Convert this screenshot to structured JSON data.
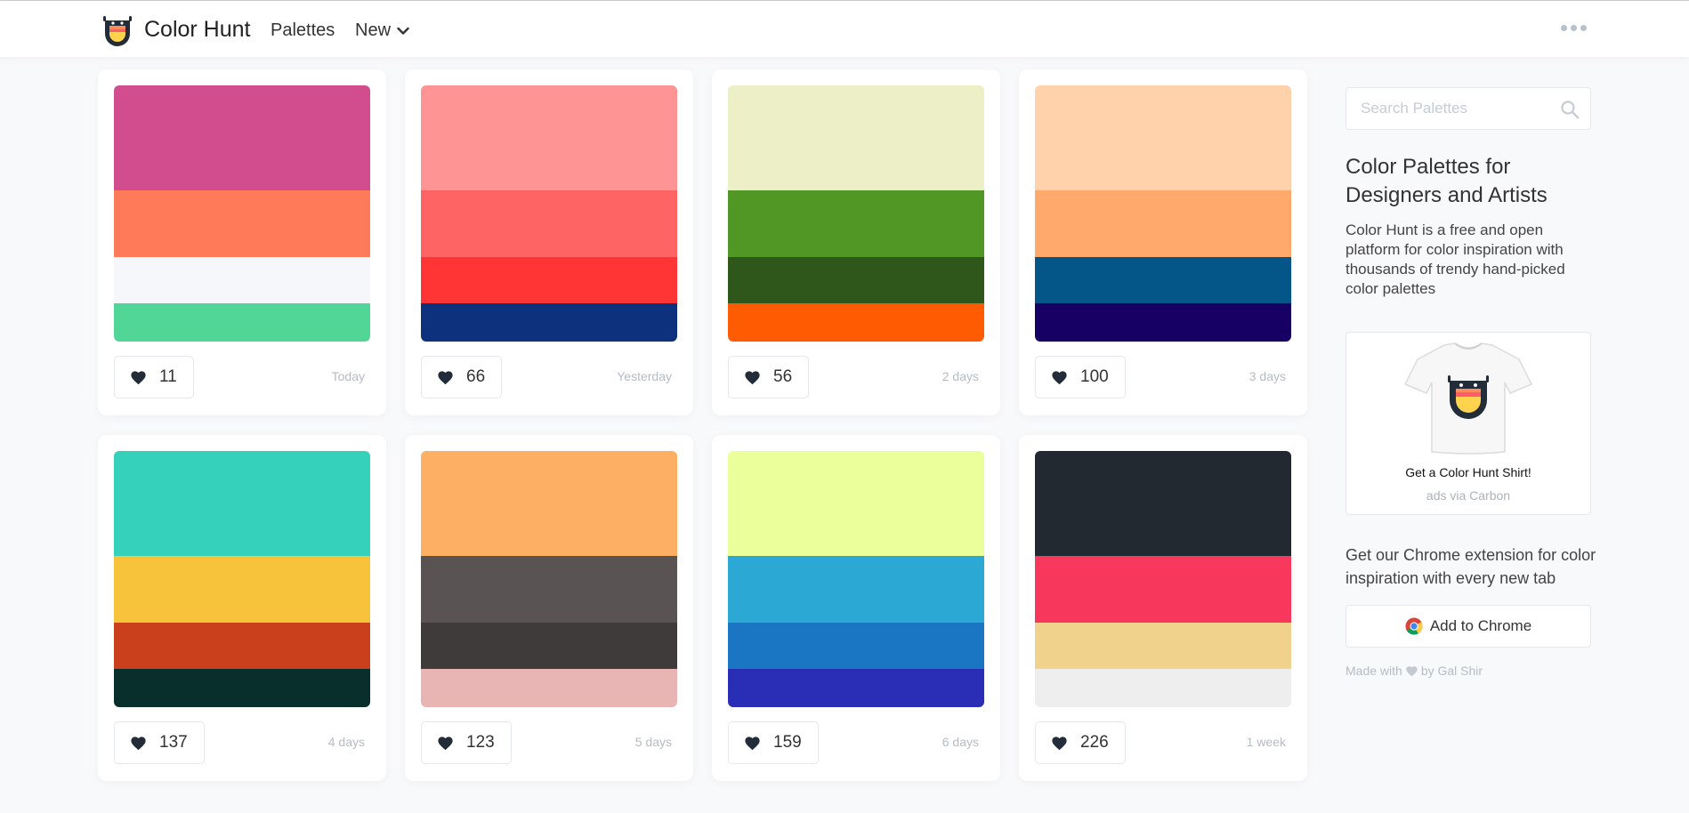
{
  "header": {
    "brand": "Color Hunt",
    "nav": {
      "palettes": "Palettes",
      "new": "New"
    },
    "more_icon": "more-dots-icon"
  },
  "palettes": [
    {
      "colors": [
        "#d24d8e",
        "#ff7a59",
        "#f6f7fb",
        "#52d698"
      ],
      "likes": "11",
      "date": "Today"
    },
    {
      "colors": [
        "#ff9494",
        "#ff6464",
        "#ff3434",
        "#0d317d"
      ],
      "likes": "66",
      "date": "Yesterday"
    },
    {
      "colors": [
        "#edefc6",
        "#519725",
        "#2f571c",
        "#fe5b02"
      ],
      "likes": "56",
      "date": "2 days"
    },
    {
      "colors": [
        "#ffd2ac",
        "#ffa96c",
        "#035687",
        "#160064"
      ],
      "likes": "100",
      "date": "3 days"
    },
    {
      "colors": [
        "#36d1bb",
        "#f6c33b",
        "#ca401c",
        "#082f2b"
      ],
      "likes": "137",
      "date": "4 days"
    },
    {
      "colors": [
        "#fdaf63",
        "#595353",
        "#403b3b",
        "#e8b4b4"
      ],
      "likes": "123",
      "date": "5 days"
    },
    {
      "colors": [
        "#ebff9b",
        "#2ba8d3",
        "#1a75c3",
        "#2a2db6"
      ],
      "likes": "159",
      "date": "6 days"
    },
    {
      "colors": [
        "#232931",
        "#f7375b",
        "#f0d28c",
        "#eeeeee"
      ],
      "likes": "226",
      "date": "1 week"
    }
  ],
  "sidebar": {
    "search_placeholder": "Search Palettes",
    "title": "Color Palettes for Designers and Artists",
    "description": "Color Hunt is a free and open platform for color inspiration with thousands of trendy hand-picked color palettes",
    "ad_title": "Get a Color Hunt Shirt!",
    "ad_via": "ads via Carbon",
    "chrome_text": "Get our Chrome extension for color inspiration with every new tab",
    "chrome_button": "Add to Chrome",
    "made_prefix": "Made with",
    "made_suffix": "by Gal Shir"
  },
  "colors": {
    "heart": "#232c39",
    "muted_text": "#b5bcc5",
    "border": "#e4e7eb"
  }
}
